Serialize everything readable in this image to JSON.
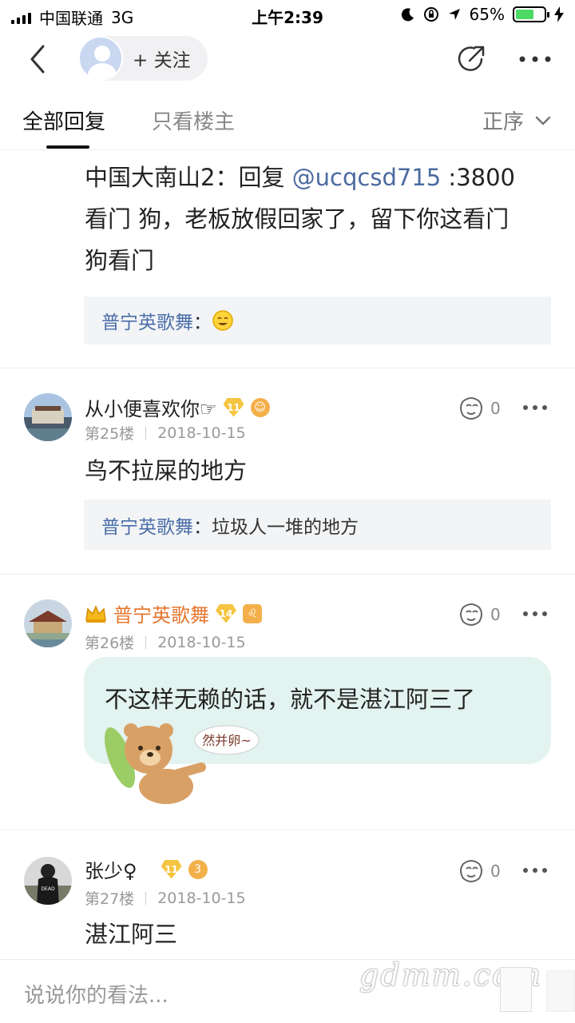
{
  "status_bar": {
    "carrier": "中国联通",
    "network": "3G",
    "time": "上午2:39",
    "battery": "65%",
    "battery_level": 0.65
  },
  "header": {
    "follow_label": "+ 关注",
    "share_icon": "share-icon",
    "more_icon": "more-icon"
  },
  "tabs": {
    "all": "全部回复",
    "owner_only": "只看楼主",
    "sort": "正序"
  },
  "first_reply": {
    "author": "中国大南山2",
    "reply_word": "：回复 ",
    "mention": "@ucqcsd715",
    "rest_line1": " :3800",
    "line2": "看门 狗，老板放假回家了，留下你这看门",
    "line3": "狗看门",
    "quote_name": "普宁英歌舞",
    "quote_sep": "："
  },
  "posts": [
    {
      "username": "从小便喜欢你☞",
      "level": "11",
      "floor": "第25楼",
      "date": "2018-10-15",
      "likes": "0",
      "content": "鸟不拉屎的地方",
      "quote_name": "普宁英歌舞",
      "quote_text": "：垃圾人一堆的地方"
    },
    {
      "username": "普宁英歌舞",
      "level": "14",
      "floor": "第26楼",
      "date": "2018-10-15",
      "likes": "0",
      "content": "不这样无赖的话，就不是湛江阿三了",
      "sticker_text": "然并卵~"
    },
    {
      "username": "张少♀",
      "level": "11",
      "floor": "第27楼",
      "date": "2018-10-15",
      "likes": "0",
      "content": "湛江阿三"
    }
  ],
  "bottom": {
    "placeholder": "说说你的看法...",
    "watermark": "gdmm.com"
  },
  "colors": {
    "accent_blue": "#4a6ea8",
    "vip_orange": "#e4762d",
    "bubble_bg": "#e3f3f0",
    "quote_bg": "#f3f4f6"
  }
}
